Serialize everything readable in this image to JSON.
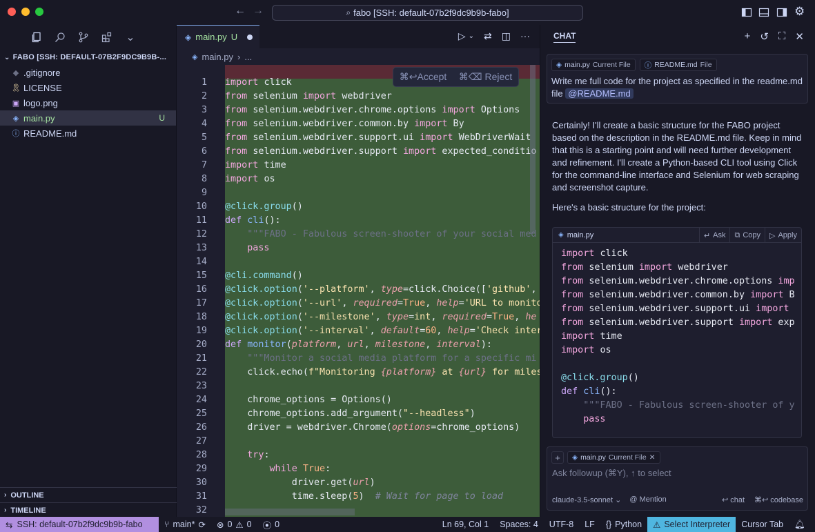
{
  "titlebar": {
    "command_center": "fabo [SSH: default-07b2f9dc9b9b-fabo]"
  },
  "sidebar": {
    "explorer_title": "FABO [SSH: DEFAULT-07B2F9DC9B9B-...",
    "files": [
      {
        "name": ".gitignore",
        "icon": "gitignore-icon",
        "glyph": "◆",
        "color": "#6c7086"
      },
      {
        "name": "LICENSE",
        "icon": "license-icon",
        "glyph": "🎗",
        "color": "#f9e2af"
      },
      {
        "name": "logo.png",
        "icon": "image-icon",
        "glyph": "▣",
        "color": "#cba6f7"
      },
      {
        "name": "main.py",
        "icon": "python-icon",
        "glyph": "◈",
        "color": "#89b4fa",
        "badge": "U"
      },
      {
        "name": "README.md",
        "icon": "info-icon",
        "glyph": "ⓘ",
        "color": "#89b4fa"
      }
    ],
    "outline": "OUTLINE",
    "timeline": "TIMELINE"
  },
  "editor": {
    "tab": {
      "label": "main.py",
      "status": "U"
    },
    "breadcrumb": {
      "file": "main.py",
      "more": "..."
    },
    "accept": "⌘↩Accept",
    "reject": "⌘⌫ Reject",
    "lines": [
      {
        "n": "1",
        "tokens": [
          [
            "kw",
            "import"
          ],
          [
            "",
            "click"
          ]
        ]
      },
      {
        "n": "2",
        "tokens": [
          [
            "kw",
            "from"
          ],
          [
            "",
            "selenium "
          ],
          [
            "kw",
            "import"
          ],
          [
            "",
            "webdriver"
          ]
        ]
      },
      {
        "n": "3",
        "tokens": [
          [
            "kw",
            "from"
          ],
          [
            "",
            "selenium.webdriver.chrome.options "
          ],
          [
            "kw",
            "import"
          ],
          [
            "",
            "Options"
          ]
        ]
      },
      {
        "n": "4",
        "tokens": [
          [
            "kw",
            "from"
          ],
          [
            "",
            "selenium.webdriver.common.by "
          ],
          [
            "kw",
            "import"
          ],
          [
            "",
            "By"
          ]
        ]
      },
      {
        "n": "5",
        "tokens": [
          [
            "kw",
            "from"
          ],
          [
            "",
            "selenium.webdriver.support.ui "
          ],
          [
            "kw",
            "import"
          ],
          [
            "",
            "WebDriverWait"
          ]
        ]
      },
      {
        "n": "6",
        "tokens": [
          [
            "kw",
            "from"
          ],
          [
            "",
            "selenium.webdriver.support "
          ],
          [
            "kw",
            "import"
          ],
          [
            "",
            "expected_conditio"
          ]
        ]
      },
      {
        "n": "7",
        "tokens": [
          [
            "kw",
            "import"
          ],
          [
            "",
            "time"
          ]
        ]
      },
      {
        "n": "8",
        "tokens": [
          [
            "kw",
            "import"
          ],
          [
            "",
            "os"
          ]
        ]
      },
      {
        "n": "9",
        "tokens": []
      },
      {
        "n": "10",
        "tokens": [
          [
            "dec",
            "@click.group"
          ],
          [
            "",
            "()"
          ]
        ]
      },
      {
        "n": "11",
        "tokens": [
          [
            "kw2",
            "def "
          ],
          [
            "fn",
            "cli"
          ],
          [
            "",
            "():"
          ]
        ]
      },
      {
        "n": "12",
        "tokens": [
          [
            "doc",
            "    \"\"\"FABO - Fabulous screen-shooter of your social med"
          ]
        ]
      },
      {
        "n": "13",
        "tokens": [
          [
            "kw",
            "    pass"
          ]
        ]
      },
      {
        "n": "14",
        "tokens": []
      },
      {
        "n": "15",
        "tokens": [
          [
            "dec",
            "@cli.command"
          ],
          [
            "",
            "()"
          ]
        ]
      },
      {
        "n": "16",
        "tokens": [
          [
            "dec",
            "@click.option"
          ],
          [
            "",
            "("
          ],
          [
            "str",
            "'--platform'"
          ],
          [
            "",
            ", "
          ],
          [
            "prm",
            "type"
          ],
          [
            "",
            "=click.Choice(["
          ],
          [
            "str",
            "'github'"
          ],
          [
            "",
            ", "
          ]
        ]
      },
      {
        "n": "17",
        "tokens": [
          [
            "dec",
            "@click.option"
          ],
          [
            "",
            "("
          ],
          [
            "str",
            "'--url'"
          ],
          [
            "",
            ", "
          ],
          [
            "prm",
            "required"
          ],
          [
            "",
            "="
          ],
          [
            "num",
            "True"
          ],
          [
            "",
            ", "
          ],
          [
            "prm",
            "help"
          ],
          [
            "",
            "="
          ],
          [
            "str",
            "'URL to monito"
          ]
        ]
      },
      {
        "n": "18",
        "tokens": [
          [
            "dec",
            "@click.option"
          ],
          [
            "",
            "("
          ],
          [
            "str",
            "'--milestone'"
          ],
          [
            "",
            ", "
          ],
          [
            "prm",
            "type"
          ],
          [
            "",
            "="
          ],
          [
            "bi",
            "int"
          ],
          [
            "",
            ", "
          ],
          [
            "prm",
            "required"
          ],
          [
            "",
            "="
          ],
          [
            "num",
            "True"
          ],
          [
            "",
            ", "
          ],
          [
            "prm",
            "he"
          ]
        ]
      },
      {
        "n": "19",
        "tokens": [
          [
            "dec",
            "@click.option"
          ],
          [
            "",
            "("
          ],
          [
            "str",
            "'--interval'"
          ],
          [
            "",
            ", "
          ],
          [
            "prm",
            "default"
          ],
          [
            "",
            "="
          ],
          [
            "num",
            "60"
          ],
          [
            "",
            ", "
          ],
          [
            "prm",
            "help"
          ],
          [
            "",
            "="
          ],
          [
            "str",
            "'Check inter"
          ]
        ]
      },
      {
        "n": "20",
        "tokens": [
          [
            "kw2",
            "def "
          ],
          [
            "fn",
            "monitor"
          ],
          [
            "",
            "("
          ],
          [
            "prm",
            "platform"
          ],
          [
            "",
            ", "
          ],
          [
            "prm",
            "url"
          ],
          [
            "",
            ", "
          ],
          [
            "prm",
            "milestone"
          ],
          [
            "",
            ", "
          ],
          [
            "prm",
            "interval"
          ],
          [
            "",
            "):"
          ]
        ]
      },
      {
        "n": "21",
        "tokens": [
          [
            "doc",
            "    \"\"\"Monitor a social media platform for a specific mi"
          ]
        ]
      },
      {
        "n": "22",
        "tokens": [
          [
            "",
            "    click.echo("
          ],
          [
            "str",
            "f\"Monitoring "
          ],
          [
            "prm",
            "{platform}"
          ],
          [
            "str",
            " at "
          ],
          [
            "prm",
            "{url}"
          ],
          [
            "str",
            " for miles"
          ]
        ]
      },
      {
        "n": "23",
        "tokens": []
      },
      {
        "n": "24",
        "tokens": [
          [
            "",
            "    chrome_options = Options()"
          ]
        ]
      },
      {
        "n": "25",
        "tokens": [
          [
            "",
            "    chrome_options.add_argument("
          ],
          [
            "str",
            "\"--headless\""
          ],
          [
            "",
            ")"
          ]
        ]
      },
      {
        "n": "26",
        "tokens": [
          [
            "",
            "    driver = webdriver.Chrome("
          ],
          [
            "prm",
            "options"
          ],
          [
            "",
            "=chrome_options)"
          ]
        ]
      },
      {
        "n": "27",
        "tokens": []
      },
      {
        "n": "28",
        "tokens": [
          [
            "kw",
            "    try"
          ],
          [
            "",
            ":"
          ]
        ]
      },
      {
        "n": "29",
        "tokens": [
          [
            "kw",
            "        while "
          ],
          [
            "num",
            "True"
          ],
          [
            "",
            ":"
          ]
        ]
      },
      {
        "n": "30",
        "tokens": [
          [
            "",
            "            driver.get("
          ],
          [
            "prm",
            "url"
          ],
          [
            "",
            ")"
          ]
        ]
      },
      {
        "n": "31",
        "tokens": [
          [
            "",
            "            time.sleep("
          ],
          [
            "num",
            "5"
          ],
          [
            "",
            ")  "
          ],
          [
            "com",
            "# Wait for page to load"
          ]
        ]
      },
      {
        "n": "32",
        "tokens": []
      }
    ]
  },
  "chat": {
    "title": "CHAT",
    "user_message": {
      "pills": [
        {
          "name": "main.py",
          "kind": "Current File",
          "icon": "python-icon"
        },
        {
          "name": "README.md",
          "kind": "File",
          "icon": "info-icon"
        }
      ],
      "text": "Write me full code for the project as specified in the readme.md file",
      "mention": "@README.md"
    },
    "ai_message": "Certainly! I'll create a basic structure for the FABO project based on the description in the README.md file. Keep in mind that this is a starting point and will need further development and refinement. I'll create a Python-based CLI tool using Click for the command-line interface and Selenium for web scraping and screenshot capture.",
    "ai_message_2": "Here's a basic structure for the project:",
    "code_block": {
      "filename": "main.py",
      "ask": "Ask",
      "copy": "Copy",
      "apply": "Apply",
      "lines": [
        [
          [
            "kw",
            "import"
          ],
          [
            "",
            "click"
          ]
        ],
        [
          [
            "kw",
            "from"
          ],
          [
            "",
            "selenium "
          ],
          [
            "kw",
            "import"
          ],
          [
            "",
            "webdriver"
          ]
        ],
        [
          [
            "kw",
            "from"
          ],
          [
            "",
            "selenium.webdriver.chrome.options "
          ],
          [
            "kw",
            "imp"
          ]
        ],
        [
          [
            "kw",
            "from"
          ],
          [
            "",
            "selenium.webdriver.common.by "
          ],
          [
            "kw",
            "import"
          ],
          [
            "",
            "B"
          ]
        ],
        [
          [
            "kw",
            "from"
          ],
          [
            "",
            "selenium.webdriver.support.ui "
          ],
          [
            "kw",
            "import"
          ]
        ],
        [
          [
            "kw",
            "from"
          ],
          [
            "",
            "selenium.webdriver.support "
          ],
          [
            "kw",
            "import"
          ],
          [
            "",
            "exp"
          ]
        ],
        [
          [
            "kw",
            "import"
          ],
          [
            "",
            "time"
          ]
        ],
        [
          [
            "kw",
            "import"
          ],
          [
            "",
            "os"
          ]
        ],
        [],
        [
          [
            "dec",
            "@click.group"
          ],
          [
            "",
            "()"
          ]
        ],
        [
          [
            "kw2",
            "def "
          ],
          [
            "fn",
            "cli"
          ],
          [
            "",
            "():"
          ]
        ],
        [
          [
            "doc",
            "    \"\"\"FABO - Fabulous screen-shooter of y"
          ]
        ],
        [
          [
            "kw",
            "    pass"
          ]
        ]
      ]
    },
    "input": {
      "pill": {
        "name": "main.py",
        "kind": "Current File"
      },
      "placeholder": "Ask followup (⌘Y), ↑ to select",
      "model": "claude-3.5-sonnet",
      "mention": "@ Mention",
      "chat_hint": "↩ chat",
      "codebase_hint": "⌘↩ codebase"
    }
  },
  "statusbar": {
    "remote": "SSH: default-07b2f9dc9b9b-fabo",
    "branch": "main*",
    "errors": "0",
    "warnings": "0",
    "ports": "0",
    "position": "Ln 69, Col 1",
    "spaces": "Spaces: 4",
    "encoding": "UTF-8",
    "eol": "LF",
    "language": "Python",
    "interpreter": "Select Interpreter",
    "cursor_tab": "Cursor Tab",
    "accent_remote": "#b18fe0",
    "accent_interpreter": "#4fb6e0"
  }
}
